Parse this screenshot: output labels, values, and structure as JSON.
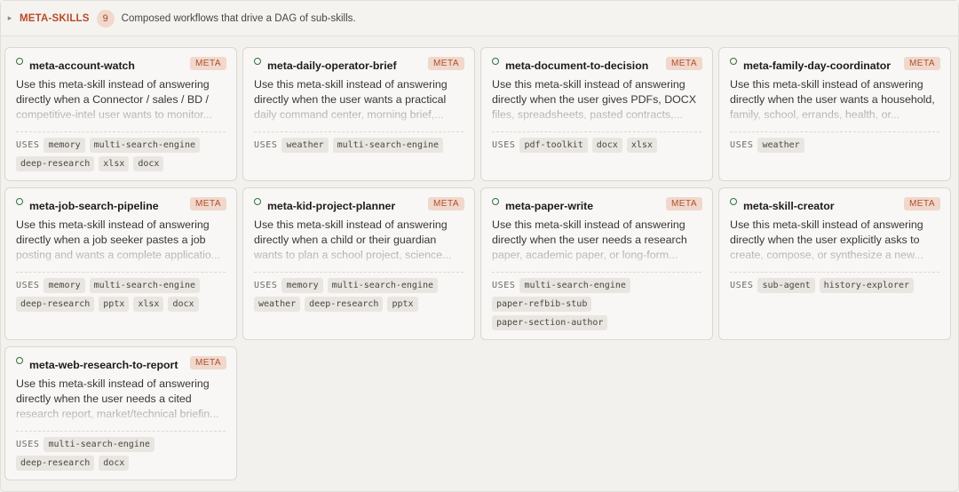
{
  "section": {
    "caret": "▸",
    "title": "META-SKILLS",
    "count": "9",
    "description": "Composed workflows that drive a DAG of sub-skills."
  },
  "uses_label": "USES",
  "cards": [
    {
      "name": "meta-account-watch",
      "badge": "META",
      "desc_line1": "Use this meta-skill instead of answering",
      "desc_line2": "directly when a Connector / sales / BD /",
      "desc_line3": "competitive-intel user wants to monitor...",
      "uses": [
        "memory",
        "multi-search-engine",
        "deep-research",
        "xlsx",
        "docx"
      ]
    },
    {
      "name": "meta-daily-operator-brief",
      "badge": "META",
      "desc_line1": "Use this meta-skill instead of answering",
      "desc_line2": "directly when the user wants a practical",
      "desc_line3": "daily command center, morning brief,...",
      "uses": [
        "weather",
        "multi-search-engine"
      ]
    },
    {
      "name": "meta-document-to-decision",
      "badge": "META",
      "desc_line1": "Use this meta-skill instead of answering",
      "desc_line2": "directly when the user gives PDFs, DOCX",
      "desc_line3": "files, spreadsheets, pasted contracts,...",
      "uses": [
        "pdf-toolkit",
        "docx",
        "xlsx"
      ]
    },
    {
      "name": "meta-family-day-coordinator",
      "badge": "META",
      "desc_line1": "Use this meta-skill instead of answering",
      "desc_line2": "directly when the user wants a household,",
      "desc_line3": "family, school, errands, health, or...",
      "uses": [
        "weather"
      ]
    },
    {
      "name": "meta-job-search-pipeline",
      "badge": "META",
      "desc_line1": "Use this meta-skill instead of answering",
      "desc_line2": "directly when a job seeker pastes a job",
      "desc_line3": "posting and wants a complete applicatio...",
      "uses": [
        "memory",
        "multi-search-engine",
        "deep-research",
        "pptx",
        "xlsx",
        "docx"
      ]
    },
    {
      "name": "meta-kid-project-planner",
      "badge": "META",
      "desc_line1": "Use this meta-skill instead of answering",
      "desc_line2": "directly when a child or their guardian",
      "desc_line3": "wants to plan a school project, science...",
      "uses": [
        "memory",
        "multi-search-engine",
        "weather",
        "deep-research",
        "pptx"
      ]
    },
    {
      "name": "meta-paper-write",
      "badge": "META",
      "desc_line1": "Use this meta-skill instead of answering",
      "desc_line2": "directly when the user needs a research",
      "desc_line3": "paper, academic paper, or long-form...",
      "uses": [
        "multi-search-engine",
        "paper-refbib-stub",
        "paper-section-author"
      ]
    },
    {
      "name": "meta-skill-creator",
      "badge": "META",
      "desc_line1": "Use this meta-skill instead of answering",
      "desc_line2": "directly when the user explicitly asks to",
      "desc_line3": "create, compose, or synthesize a new...",
      "uses": [
        "sub-agent",
        "history-explorer"
      ]
    },
    {
      "name": "meta-web-research-to-report",
      "badge": "META",
      "desc_line1": "Use this meta-skill instead of answering",
      "desc_line2": "directly when the user needs a cited",
      "desc_line3": "research report, market/technical briefin...",
      "uses": [
        "multi-search-engine",
        "deep-research",
        "docx"
      ]
    }
  ]
}
